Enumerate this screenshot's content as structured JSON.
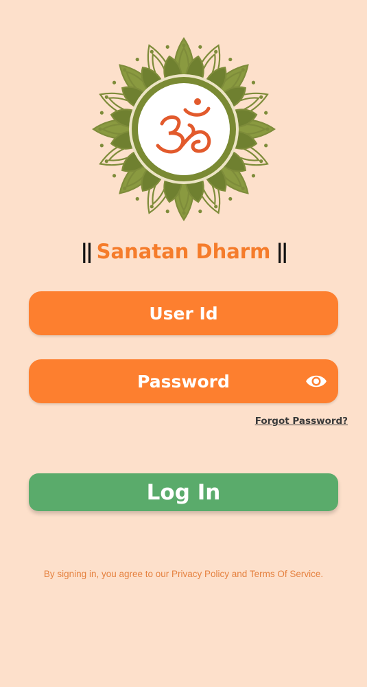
{
  "app": {
    "title_bars_left": "||",
    "title": "Sanatan Dharm",
    "title_bars_right": "||"
  },
  "form": {
    "user_id_placeholder": "User Id",
    "password_placeholder": "Password",
    "forgot_password": "Forgot Password?",
    "login_label": "Log In"
  },
  "footer": {
    "terms_text": "By signing in, you agree to our Privacy Policy and Terms Of Service."
  },
  "icons": {
    "logo": "om-mandala-icon",
    "password_toggle": "eye-icon"
  },
  "colors": {
    "background": "#fde0cb",
    "accent": "#fd7f2f",
    "login_button": "#5aab6b",
    "mandala": "#7e8c3a",
    "om": "#e25a2c",
    "terms_text": "#e5813f"
  }
}
